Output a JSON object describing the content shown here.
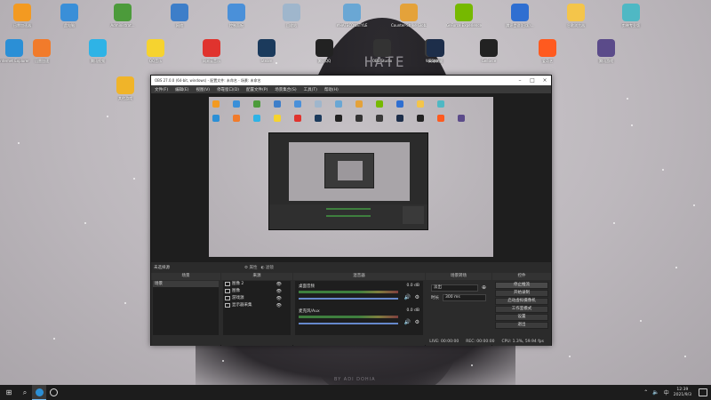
{
  "desktop": {
    "hat_text": "HATE",
    "byline": "BY ADI DOHIA",
    "icons_row1": [
      {
        "label": "迅雷加速器",
        "icon": "thunder-icon",
        "color": "#f39a21"
      },
      {
        "label": "此电脑",
        "icon": "computer-icon",
        "color": "#3a8fd8"
      },
      {
        "label": "Administrat...",
        "icon": "user-folder-icon",
        "color": "#4c9b3b"
      },
      {
        "label": "网络",
        "icon": "network-icon",
        "color": "#3d7ec9"
      },
      {
        "label": "控制面板",
        "icon": "control-panel-icon",
        "color": "#4a90d9"
      },
      {
        "label": "回收站",
        "icon": "recycle-bin-icon",
        "color": "#9fb6cc"
      },
      {
        "label": "#HATECONSTYLE",
        "icon": "hatecon-icon",
        "color": "#6aa7d4"
      },
      {
        "label": "Counter-Strike Global Offe...",
        "icon": "csgo-icon",
        "color": "#e4a23a"
      },
      {
        "label": "GeForce Experience",
        "icon": "geforce-icon",
        "color": "#76b900"
      },
      {
        "label": "腾讯会议(旧版)...",
        "icon": "tencent-meeting-icon",
        "color": "#2f6fd1"
      },
      {
        "label": "谷歌浏览器",
        "icon": "file-icon",
        "color": "#f4c54a"
      },
      {
        "label": "剪映专业版",
        "icon": "capcut-icon",
        "color": "#4fb8c4"
      }
    ],
    "icons_row2": [
      {
        "label": "Internet Explorer",
        "icon": "ie-icon",
        "color": "#2b8fd6"
      },
      {
        "label": "迅雷加速",
        "icon": "xunlei-icon",
        "color": "#f17b2b"
      },
      {
        "label": "腾讯视频",
        "icon": "tencent-video-icon",
        "color": "#2eb3e6"
      },
      {
        "label": "QQ音乐",
        "icon": "qq-music-icon",
        "color": "#f6d32f"
      },
      {
        "label": "网易云音乐",
        "icon": "netease-music-icon",
        "color": "#e0332e"
      },
      {
        "label": "Steam",
        "icon": "steam-icon",
        "color": "#1b3a5c"
      },
      {
        "label": "腾讯QQ",
        "icon": "qq-icon",
        "color": "#222222"
      },
      {
        "label": "OBS Studio",
        "icon": "obs-icon",
        "color": "#333333"
      },
      {
        "label": "WeGame",
        "icon": "wegame-icon",
        "color": "#3a3a3a"
      },
      {
        "label": "英雄联盟",
        "icon": "lol-icon",
        "color": "#1d2e4a"
      },
      {
        "label": "GeForce",
        "icon": "game-icon",
        "color": "#222222"
      },
      {
        "label": "爱奇艺",
        "icon": "video-icon",
        "color": "#ff5a1f"
      },
      {
        "label": "腾讯游戏",
        "icon": "tencent-game-icon",
        "color": "#5b4b8a"
      }
    ],
    "icons_row3": [
      {
        "label": "其他游戏",
        "icon": "game-folder-icon",
        "color": "#f0b429"
      }
    ]
  },
  "obs": {
    "title": "OBS 27.0.0 (64-bit, windows) - 配置文件: 未命名 - 场景: 未命名",
    "menu": [
      "文件(F)",
      "编辑(E)",
      "视图(V)",
      "停靠窗口(D)",
      "配置文件(P)",
      "场景集合(S)",
      "工具(T)",
      "帮助(H)"
    ],
    "scenes_bar_label": "未选择源",
    "properties_btn": "属性",
    "filters_btn": "滤镜",
    "scenes_title": "场景",
    "scenes": [
      "场景"
    ],
    "sources_title": "来源",
    "sources": [
      {
        "label": "图像 2",
        "icon": "image-icon"
      },
      {
        "label": "图像",
        "icon": "image-icon"
      },
      {
        "label": "游戏源",
        "icon": "game-source-icon"
      },
      {
        "label": "显示器采集",
        "icon": "monitor-icon"
      }
    ],
    "mixer_title": "混音器",
    "mixer": [
      {
        "name": "桌面音频",
        "db": "0.0 dB"
      },
      {
        "name": "麦克风/Aux",
        "db": "0.0 dB"
      }
    ],
    "transitions_title": "场景转场",
    "transition_type": "淡出",
    "duration_label": "时长",
    "duration": "300 ms",
    "controls_title": "控件",
    "controls": [
      "停止推流",
      "开始录制",
      "启动虚拟摄像机",
      "工作室模式",
      "设置",
      "退出"
    ],
    "status": {
      "live": "LIVE: 00:00:00",
      "rec": "REC: 00:00:00",
      "cpu": "CPU: 1.3%, 59.94 fps"
    }
  },
  "taskbar": {
    "time": "12:39",
    "date": "2021/9/3",
    "lang": "中"
  }
}
